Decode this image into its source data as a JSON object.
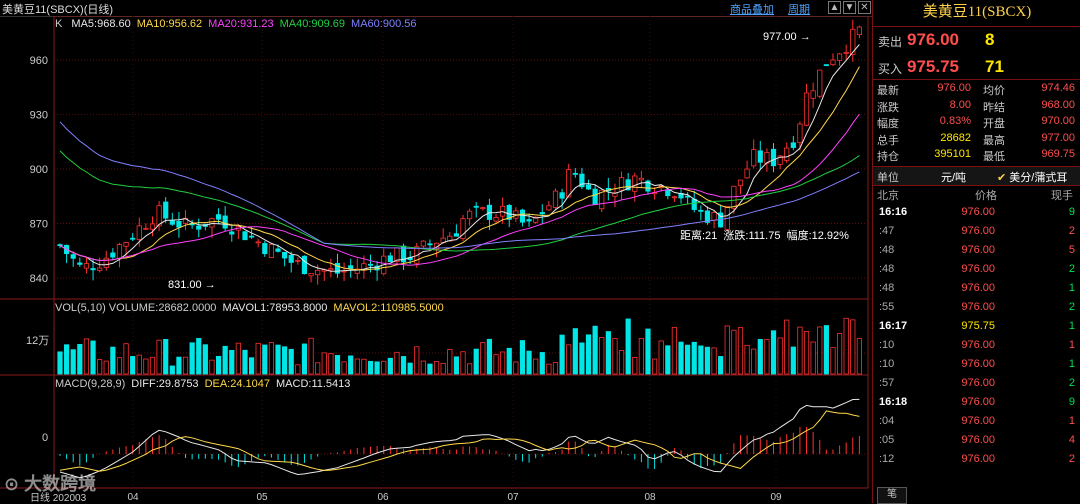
{
  "topbar": {
    "title": "美黄豆11(SBCX)(日线)",
    "link_product": "商品叠加",
    "link_period": "周期"
  },
  "main": {
    "indicator_label": "K",
    "ma": [
      {
        "label": "MA5:968.60",
        "color": "#e8e8e8"
      },
      {
        "label": "MA10:956.62",
        "color": "#ffd84a"
      },
      {
        "label": "MA20:931.23",
        "color": "#ff40ff"
      },
      {
        "label": "MA40:909.69",
        "color": "#20d040"
      },
      {
        "label": "MA60:900.56",
        "color": "#8080ff"
      }
    ],
    "high_marker": "977.00",
    "low_marker": "831.00",
    "range_info": "距离:21  涨跌:111.75  幅度:12.92%"
  },
  "volume": {
    "label": "VOL(5,10) VOLUME:28682.0000",
    "mavol1": "MAVOL1:78953.8000",
    "mavol2": "MAVOL2:110985.5000",
    "axis": "12万"
  },
  "macd": {
    "label": "MACD(9,28,9)",
    "diff": "DIFF:29.8753",
    "dea": "DEA:24.1047",
    "macd": "MACD:11.5413",
    "axis": "0"
  },
  "footer": {
    "period": "日线",
    "date_start": "202003",
    "watermark": "大数跨境"
  },
  "chart_data": {
    "type": "candlestick",
    "yticks": [
      840,
      870,
      900,
      930,
      960
    ],
    "xlabels": [
      "04",
      "05",
      "06",
      "07",
      "08",
      "09"
    ],
    "ylim": [
      829,
      983
    ]
  },
  "panel": {
    "title": "美黄豆11(SBCX)",
    "ask": {
      "label": "卖出",
      "price": "976.00",
      "qty": "8"
    },
    "bid": {
      "label": "买入",
      "price": "975.75",
      "qty": "71"
    },
    "stats": [
      {
        "l": "最新",
        "v": "976.00",
        "l2": "均价",
        "v2": "974.46"
      },
      {
        "l": "涨跌",
        "v": "8.00",
        "l2": "昨结",
        "v2": "968.00"
      },
      {
        "l": "幅度",
        "v": "0.83%",
        "l2": "开盘",
        "v2": "970.00"
      },
      {
        "l": "总手",
        "v": "28682",
        "l2": "最高",
        "v2": "977.00"
      },
      {
        "l": "持仓",
        "v": "395101",
        "l2": "最低",
        "v2": "969.75"
      }
    ],
    "unit_label": "单位",
    "unit_value": "元/吨",
    "unit_check": "美分/蒲式耳",
    "trade_head": [
      "北京",
      "价格",
      "现手"
    ],
    "trades": [
      {
        "t": "16:16",
        "p": "976.00",
        "q": "9",
        "b": true,
        "qc": "green"
      },
      {
        "t": ":47",
        "p": "976.00",
        "q": "2",
        "qc": "red"
      },
      {
        "t": ":48",
        "p": "976.00",
        "q": "5",
        "qc": "red"
      },
      {
        "t": ":48",
        "p": "976.00",
        "q": "2",
        "qc": "green"
      },
      {
        "t": ":48",
        "p": "976.00",
        "q": "1",
        "qc": "green"
      },
      {
        "t": ":55",
        "p": "976.00",
        "q": "2",
        "qc": "green"
      },
      {
        "t": "16:17",
        "p": "975.75",
        "q": "1",
        "b": true,
        "qc": "green"
      },
      {
        "t": ":10",
        "p": "976.00",
        "q": "1",
        "qc": "red"
      },
      {
        "t": ":10",
        "p": "976.00",
        "q": "1",
        "qc": "green"
      },
      {
        "t": ":57",
        "p": "976.00",
        "q": "2",
        "qc": "green"
      },
      {
        "t": "16:18",
        "p": "976.00",
        "q": "9",
        "b": true,
        "qc": "green"
      },
      {
        "t": ":04",
        "p": "976.00",
        "q": "1",
        "qc": "red"
      },
      {
        "t": ":05",
        "p": "976.00",
        "q": "4",
        "qc": "red"
      },
      {
        "t": ":12",
        "p": "976.00",
        "q": "2",
        "qc": "red"
      }
    ],
    "tab": "笔"
  }
}
